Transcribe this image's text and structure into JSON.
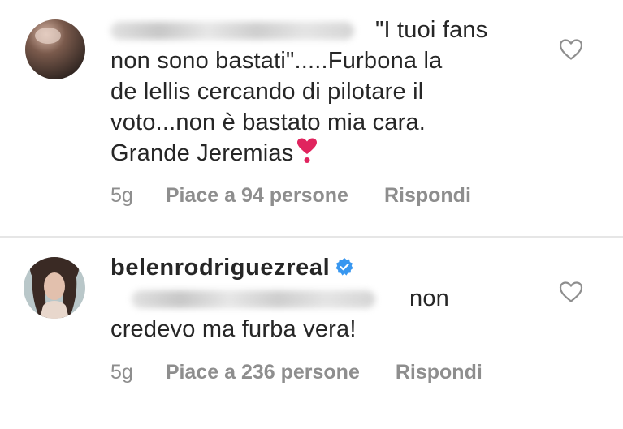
{
  "comments": [
    {
      "username": "",
      "text_lines": [
        "\"I tuoi fans",
        "non sono bastati\".....Furbona  la",
        "de lellis cercando di pilotare il",
        "voto...non è bastato mia cara.",
        "Grande Jeremias"
      ],
      "emoji": "heart-exclamation-emoji",
      "time": "5g",
      "likes": "Piace a 94 persone",
      "reply": "Rispondi",
      "like_icon": "heart-outline-icon"
    },
    {
      "username": "belenrodriguezreal",
      "verified": true,
      "text_lines": [
        "non",
        "credevo ma furba vera!"
      ],
      "time": "5g",
      "likes": "Piace a 236 persone",
      "reply": "Rispondi",
      "like_icon": "heart-outline-icon"
    }
  ],
  "colors": {
    "text": "#262626",
    "meta": "#8e8e8e",
    "verified": "#3897f0",
    "divider": "#e6e6e6",
    "emoji_heart": "#e0245e"
  }
}
